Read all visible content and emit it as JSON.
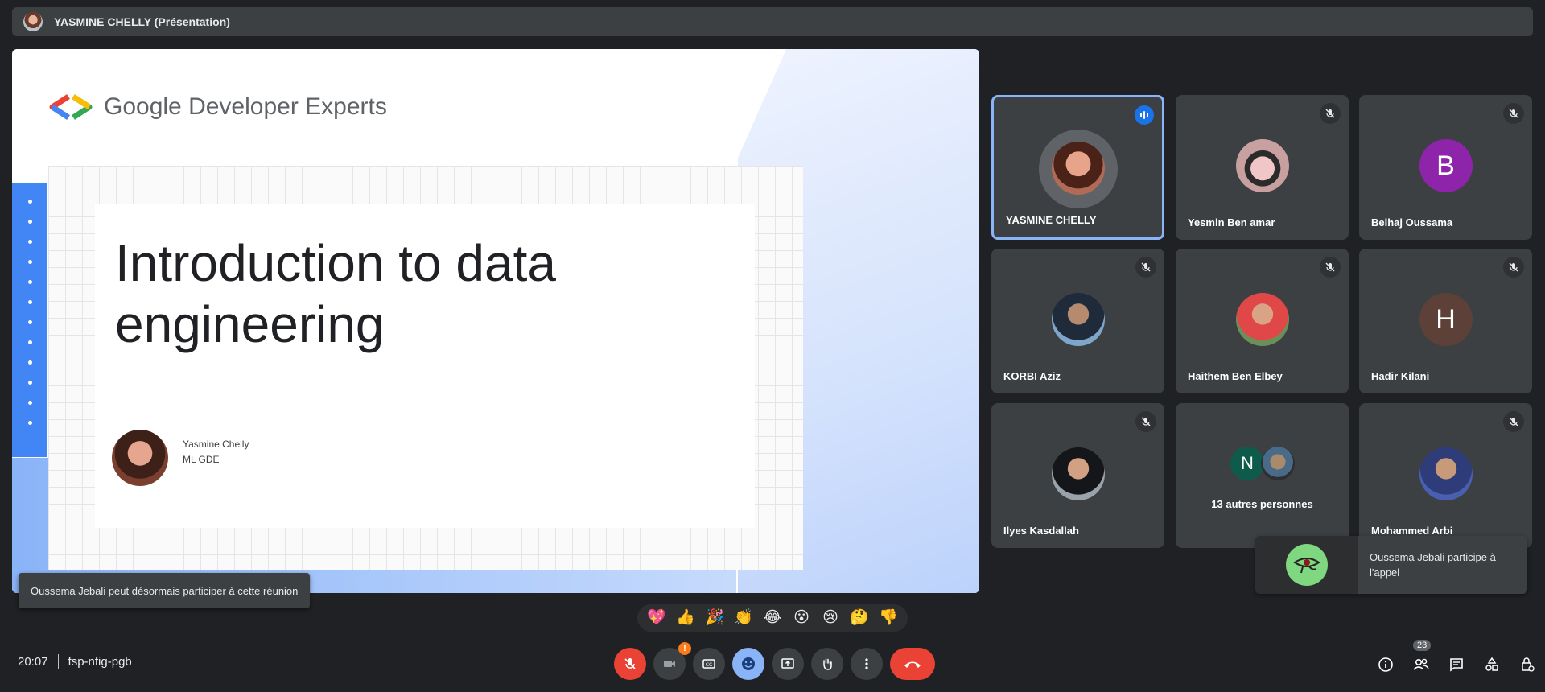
{
  "presenter_bar": {
    "title": "YASMINE CHELLY (Présentation)"
  },
  "slide": {
    "brand": "Google Developer Experts",
    "heading_line1": "Introduction to data",
    "heading_line2": "engineering",
    "speaker_name": "Yasmine Chelly",
    "speaker_role": "ML GDE"
  },
  "participants": [
    {
      "name": "YASMINE CHELLY",
      "status": "speaking"
    },
    {
      "name": "Yesmin Ben amar",
      "status": "muted"
    },
    {
      "name": "Belhaj Oussama",
      "status": "muted",
      "initial": "B",
      "color": "#8e24aa"
    },
    {
      "name": "KORBI Aziz",
      "status": "muted"
    },
    {
      "name": "Haithem Ben Elbey",
      "status": "muted"
    },
    {
      "name": "Hadir Kilani",
      "status": "muted",
      "initial": "H",
      "color": "#5d4037"
    },
    {
      "name": "Ilyes Kasdallah",
      "status": "muted"
    },
    {
      "name": "13 autres personnes",
      "initial": "N",
      "color": "#0f5b4b"
    },
    {
      "name": "Mohammed Arbi",
      "status": "muted"
    }
  ],
  "notification": {
    "text": "Oussema Jebali participe à l'appel"
  },
  "toast": {
    "text": "Oussema Jebali peut désormais participer à cette réunion"
  },
  "reactions": [
    "💖",
    "👍",
    "🎉",
    "👏",
    "😂",
    "😮",
    "😢",
    "🤔",
    "👎"
  ],
  "meeting": {
    "time": "20:07",
    "code": "fsp-nfig-pgb"
  },
  "controls": {
    "camera_alert": "!",
    "participants_count": "23"
  },
  "colors": {
    "background": "#202124",
    "tile": "#3c4043",
    "accent": "#8ab4f8",
    "hangup": "#ea4335"
  }
}
